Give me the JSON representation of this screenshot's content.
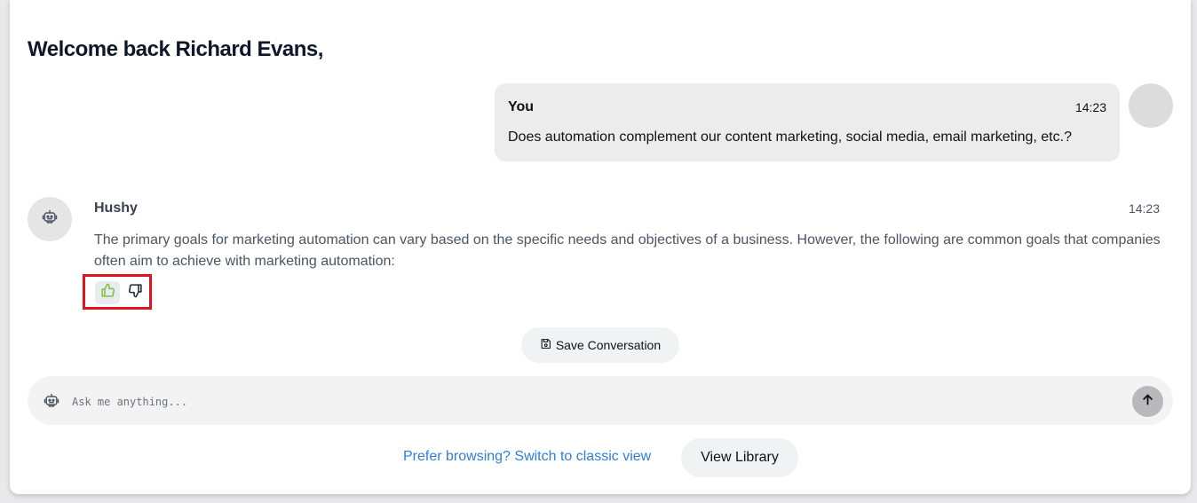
{
  "header": {
    "welcome_text": "Welcome back Richard Evans,"
  },
  "conversation": {
    "user_message": {
      "sender": "You",
      "time": "14:23",
      "text": "Does automation complement our content marketing, social media, email marketing, etc.?"
    },
    "bot_message": {
      "sender": "Hushy",
      "time": "14:23",
      "text": "The primary goals for marketing automation can vary based on the specific needs and objectives of a business. However, the following are common goals that companies often aim to achieve with marketing automation:"
    },
    "feedback": {
      "up_icon": "thumbs-up-icon",
      "down_icon": "thumbs-down-icon",
      "highlight_color": "#e0141e",
      "up_color": "#7cc242"
    }
  },
  "actions": {
    "save_label": "Save Conversation",
    "save_icon": "save-icon"
  },
  "composer": {
    "placeholder": "Ask me anything...",
    "bot_icon": "robot-icon",
    "send_icon": "arrow-up-icon"
  },
  "footer": {
    "classic_link": "Prefer browsing? Switch to classic view",
    "library_label": "View Library"
  }
}
